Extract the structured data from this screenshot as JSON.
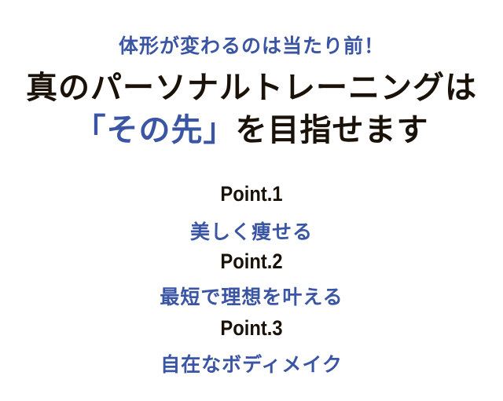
{
  "kicker": "体形が変わるのは当たり前！",
  "headline": {
    "line1": "真のパーソナルトレーニングは",
    "line2_accent": "「その先」",
    "line2_rest": "を目指せます"
  },
  "points": [
    {
      "label": "Point.1",
      "text": "美しく痩せる"
    },
    {
      "label": "Point.2",
      "text": "最短で理想を叶える"
    },
    {
      "label": "Point.3",
      "text": "自在なボディメイク"
    }
  ],
  "colors": {
    "accent": "#3a55a4",
    "text": "#1a1208",
    "background": "#ffffff"
  }
}
